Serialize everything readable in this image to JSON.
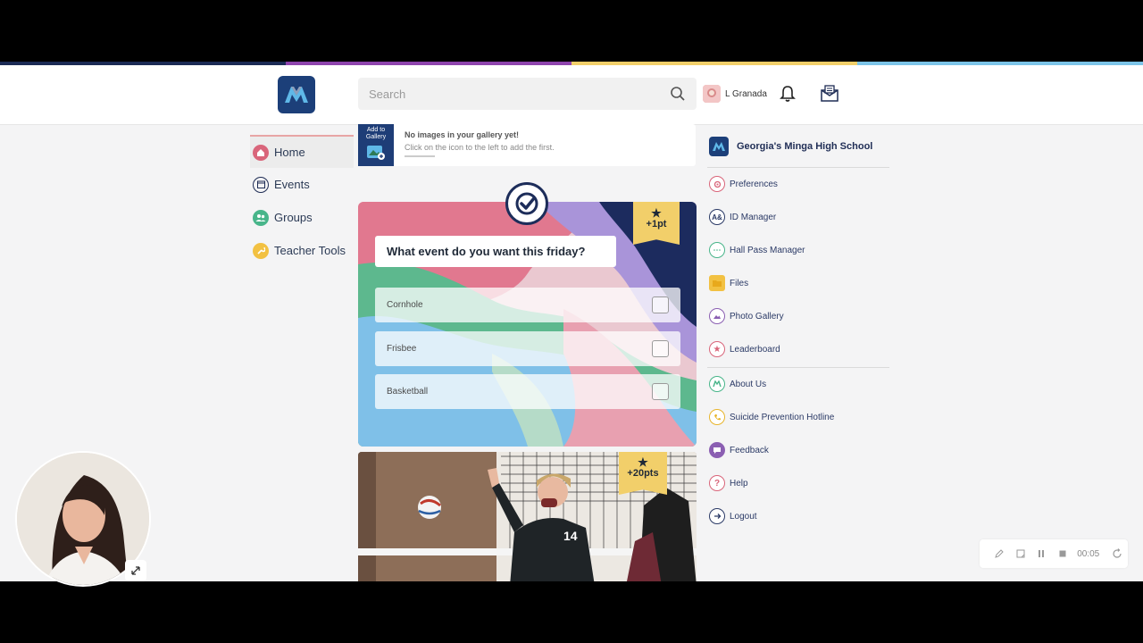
{
  "header": {
    "search_placeholder": "Search",
    "user_name": "L Granada"
  },
  "left_nav": {
    "items": [
      {
        "label": "Home"
      },
      {
        "label": "Events"
      },
      {
        "label": "Groups"
      },
      {
        "label": "Teacher Tools"
      }
    ]
  },
  "gallery": {
    "thumb_label": "Add to Gallery",
    "title": "No images in your gallery yet!",
    "subtitle": "Click on the icon to the left to add the first."
  },
  "poll": {
    "question": "What event do you want this friday?",
    "points": "+1pt",
    "options": [
      {
        "label": "Cornhole"
      },
      {
        "label": "Frisbee"
      },
      {
        "label": "Basketball"
      }
    ]
  },
  "photo_post": {
    "points": "+20pts",
    "jersey_number": "14"
  },
  "right_nav": {
    "school_name": "Georgia's Minga High School",
    "items": [
      {
        "label": "Preferences",
        "icon": "gear-icon",
        "color": "#d9657a"
      },
      {
        "label": "ID Manager",
        "icon": "id-card-icon",
        "color": "#2b3a66"
      },
      {
        "label": "Hall Pass Manager",
        "icon": "hall-pass-icon",
        "color": "#48b58a"
      },
      {
        "label": "Files",
        "icon": "folder-icon",
        "color": "#e8b52c"
      },
      {
        "label": "Photo Gallery",
        "icon": "photo-gallery-icon",
        "color": "#8b5fb2"
      },
      {
        "label": "Leaderboard",
        "icon": "star-icon",
        "color": "#d9657a"
      },
      {
        "label": "About Us",
        "icon": "minga-logo-icon",
        "color": "#48b58a"
      },
      {
        "label": "Suicide Prevention Hotline",
        "icon": "phone-icon",
        "color": "#e8b52c"
      },
      {
        "label": "Feedback",
        "icon": "chat-icon",
        "color": "#8b5fb2"
      },
      {
        "label": "Help",
        "icon": "help-icon",
        "color": "#d9657a"
      },
      {
        "label": "Logout",
        "icon": "logout-icon",
        "color": "#2b3a66"
      }
    ]
  },
  "recorder": {
    "time": "00:05"
  },
  "colors": {
    "brand_navy": "#1c3f79",
    "stripe_navy": "#1b2b55",
    "stripe_purple": "#8e44ad",
    "stripe_yellow": "#f2cf6a",
    "stripe_blue": "#7cc4e8"
  }
}
